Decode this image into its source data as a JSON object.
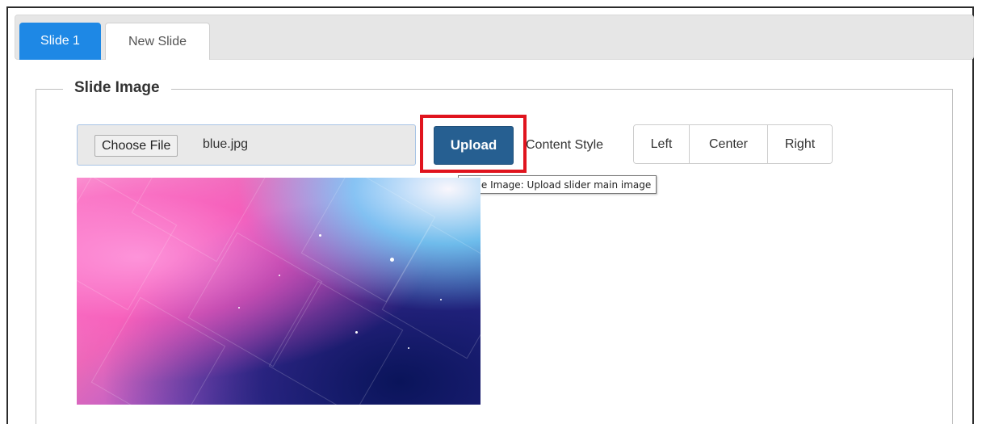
{
  "tabs": [
    {
      "label": "Slide 1",
      "active": true
    },
    {
      "label": "New Slide",
      "active": false
    }
  ],
  "section": {
    "legend": "Slide Image"
  },
  "file_input": {
    "button_label": "Choose File",
    "file_name": "blue.jpg"
  },
  "upload": {
    "label": "Upload",
    "tooltip": "Slide Image: Upload slider main image"
  },
  "content_style": {
    "label": "Content Style",
    "options": [
      "Left",
      "Center",
      "Right"
    ]
  },
  "image": {
    "alt_name": "slide-preview-image"
  },
  "colors": {
    "active_tab": "#1e88e5",
    "upload_button": "#265f91",
    "highlight_box": "#e0141e"
  }
}
